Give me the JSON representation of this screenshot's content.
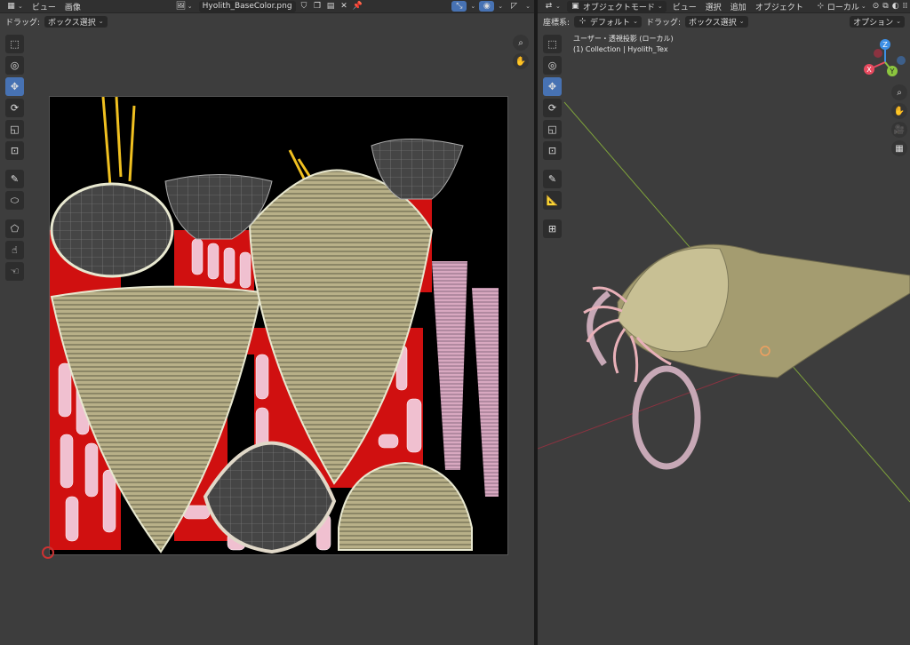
{
  "left_editor": {
    "menu": [
      "ビュー",
      "画像"
    ],
    "image_name": "Hyolith_BaseColor.png",
    "drag_label": "ドラッグ:",
    "drag_value": "ボックス選択"
  },
  "right_editor": {
    "mode": "オブジェクトモード",
    "menu": [
      "ビュー",
      "選択",
      "追加",
      "オブジェクト"
    ],
    "transform_space": "ローカル",
    "coord_label": "座標系:",
    "coord_value": "デフォルト",
    "drag_label": "ドラッグ:",
    "drag_value": "ボックス選択",
    "options": "オプション",
    "overlay_title": "ユーザー・透視投影 (ローカル)",
    "overlay_collection": "(1) Collection | Hyolith_Tex",
    "gizmo_axes": [
      "Z",
      "X",
      "Y"
    ]
  },
  "colors": {
    "accent": "#4772b3",
    "axis_x": "#e84a5f",
    "axis_y": "#8cc63f",
    "axis_z": "#3d8fe5"
  },
  "icons": [
    "editor-type-icon",
    "image-icon",
    "shield-icon",
    "copy-icon",
    "save-icon",
    "close-icon",
    "pin-icon",
    "select-box-icon",
    "cursor-icon",
    "move-icon",
    "rotate-icon",
    "scale-icon",
    "transform-icon",
    "annotate-icon",
    "measure-icon",
    "add-cube-icon",
    "zoom-icon",
    "hand-icon",
    "camera-icon",
    "grid-icon"
  ]
}
